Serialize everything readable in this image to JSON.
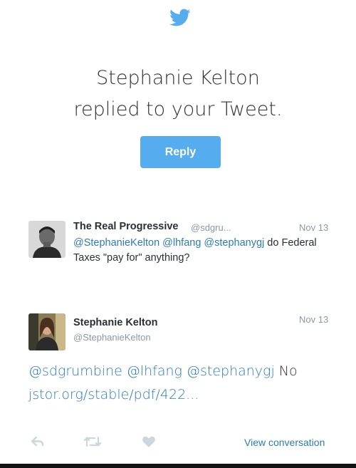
{
  "header": {
    "icon": "twitter-bird-icon",
    "accent_color": "#55acee",
    "line1": "Stephanie Kelton",
    "line2": "replied to your Tweet.",
    "reply_label": "Reply"
  },
  "original_tweet": {
    "name": "The Real Progressive",
    "handle": "@sdgru...",
    "date": "Nov 13",
    "mentions": "@StephanieKelton @lhfang @stephanygj",
    "text_rest": " do Federal Taxes \"pay for\" anything?"
  },
  "reply_tweet": {
    "name": "Stephanie Kelton",
    "handle": "@StephanieKelton",
    "date": "Nov 13",
    "mentions": "@sdgrumbine @lhfang @stephanygj",
    "word": " No",
    "link": "jstor.org/stable/pdf/422..."
  },
  "actions": {
    "reply_icon": "reply-arrow-icon",
    "retweet_icon": "retweet-icon",
    "like_icon": "heart-icon",
    "view_conversation": "View conversation"
  }
}
